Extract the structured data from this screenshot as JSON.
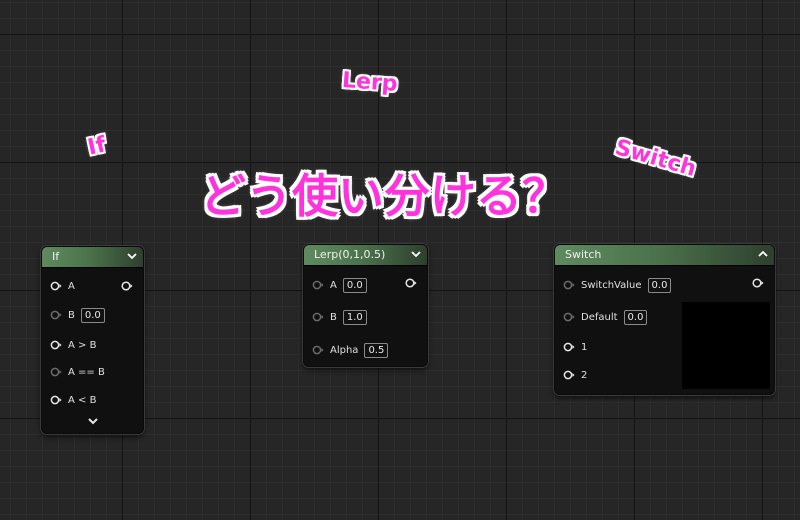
{
  "overlay": {
    "if_label": "If",
    "lerp_label": "Lerp",
    "switch_label": "Switch",
    "main_text": "どう使い分ける？",
    "text_color": "#ff33dd"
  },
  "nodes": {
    "if": {
      "title": "If",
      "inputs": {
        "a": "A",
        "b": "B",
        "b_value": "0.0",
        "a_gt_b": "A > B",
        "a_eq_b": "A == B",
        "a_lt_b": "A < B"
      }
    },
    "lerp": {
      "title": "Lerp(0,1,0.5)",
      "inputs": {
        "a": "A",
        "a_value": "0.0",
        "b": "B",
        "b_value": "1.0",
        "alpha": "Alpha",
        "alpha_value": "0.5"
      }
    },
    "switch": {
      "title": "Switch",
      "inputs": {
        "switch_value": "SwitchValue",
        "switch_value_value": "0.0",
        "default": "Default",
        "default_value": "0.0",
        "in1": "1",
        "in2": "2"
      }
    }
  },
  "colors": {
    "header_green": "#5f8a5f",
    "grid_major": "#141414",
    "grid_minor": "#2e2e2e",
    "background": "#262626"
  },
  "icons": {
    "collapse": "chevron-down-icon",
    "expand": "chevron-up-icon",
    "pin_connected": "exec-pin-icon",
    "pin_disconnected": "pin-dim-icon"
  }
}
